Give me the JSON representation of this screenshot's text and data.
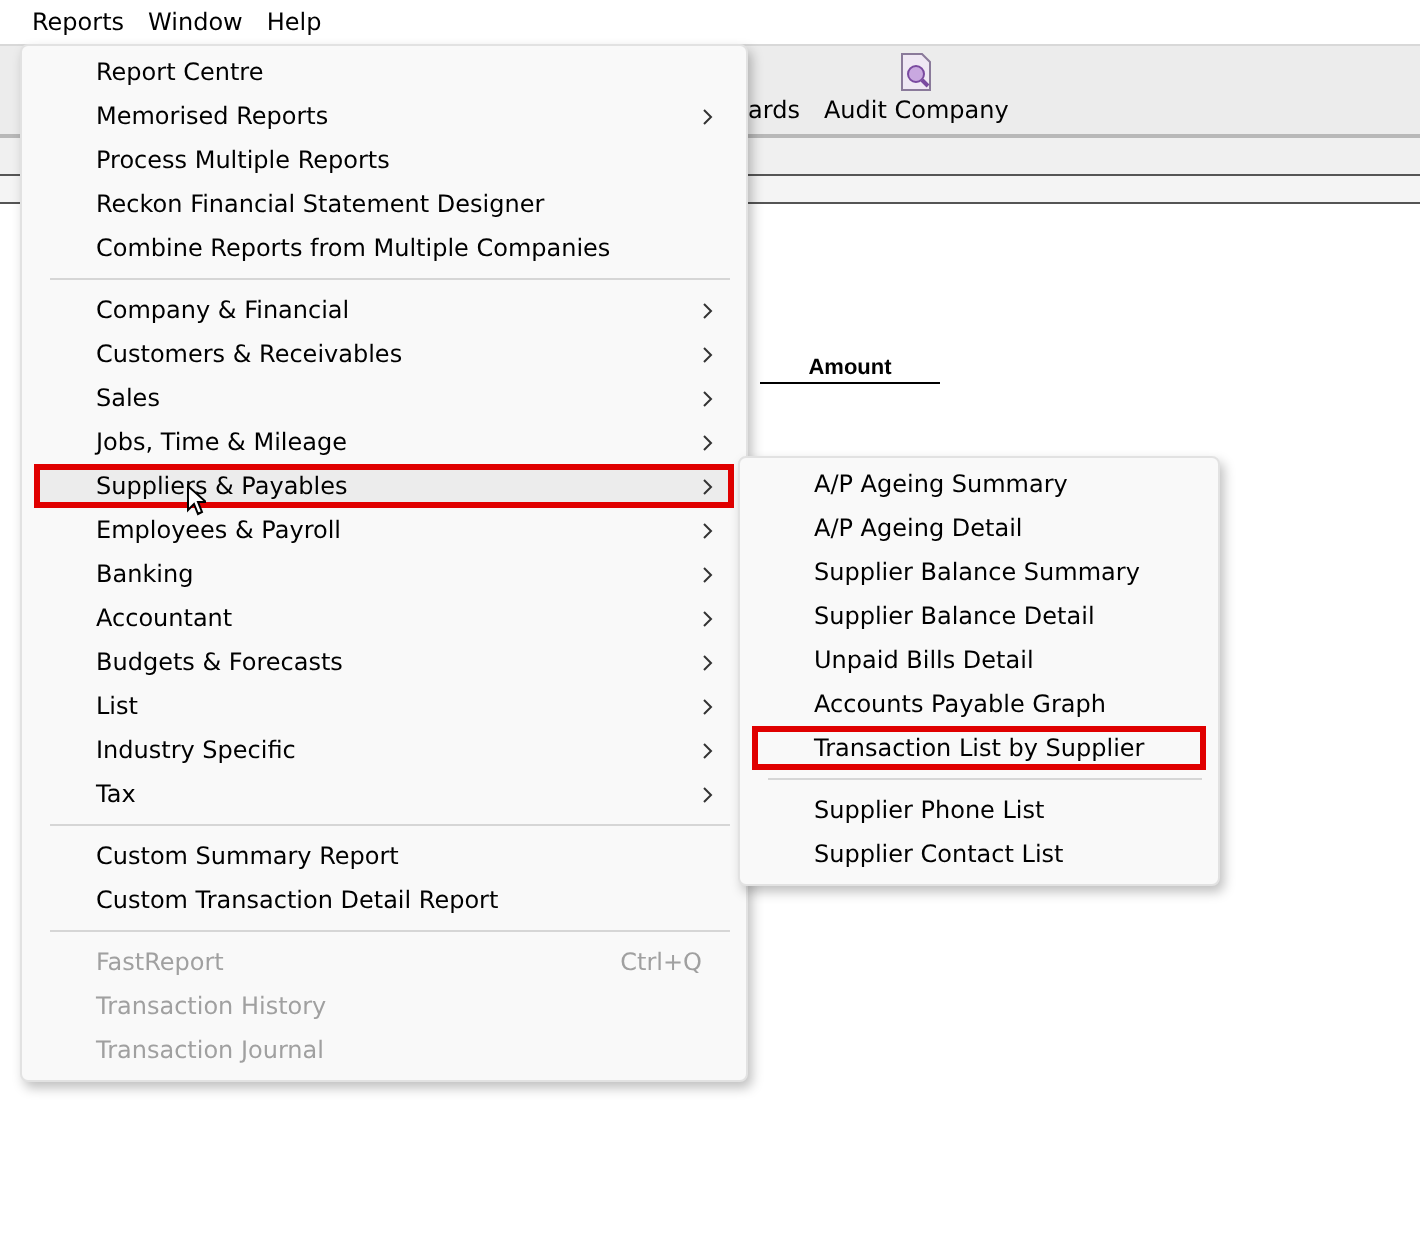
{
  "menubar": [
    {
      "label": "Reports"
    },
    {
      "label": "Window"
    },
    {
      "label": "Help"
    }
  ],
  "toolbar": [
    {
      "label": "ards",
      "icon": false
    },
    {
      "label": "Audit Company",
      "icon": true
    }
  ],
  "report": {
    "column": "Amount"
  },
  "menu": {
    "sections": [
      [
        {
          "label": "Report Centre",
          "submenu": false,
          "disabled": false,
          "selected": false,
          "highlighted": false
        },
        {
          "label": "Memorised Reports",
          "submenu": true,
          "disabled": false,
          "selected": false,
          "highlighted": false
        },
        {
          "label": "Process Multiple Reports",
          "submenu": false,
          "disabled": false,
          "selected": false,
          "highlighted": false
        },
        {
          "label": "Reckon Financial Statement Designer",
          "submenu": false,
          "disabled": false,
          "selected": false,
          "highlighted": false
        },
        {
          "label": "Combine Reports from Multiple Companies",
          "submenu": false,
          "disabled": false,
          "selected": false,
          "highlighted": false
        }
      ],
      [
        {
          "label": "Company & Financial",
          "submenu": true,
          "disabled": false,
          "selected": false,
          "highlighted": false
        },
        {
          "label": "Customers & Receivables",
          "submenu": true,
          "disabled": false,
          "selected": false,
          "highlighted": false
        },
        {
          "label": "Sales",
          "submenu": true,
          "disabled": false,
          "selected": false,
          "highlighted": false
        },
        {
          "label": "Jobs, Time & Mileage",
          "submenu": true,
          "disabled": false,
          "selected": false,
          "highlighted": false
        },
        {
          "label": "Suppliers & Payables",
          "submenu": true,
          "disabled": false,
          "selected": true,
          "highlighted": true
        },
        {
          "label": "Employees & Payroll",
          "submenu": true,
          "disabled": false,
          "selected": false,
          "highlighted": false
        },
        {
          "label": "Banking",
          "submenu": true,
          "disabled": false,
          "selected": false,
          "highlighted": false
        },
        {
          "label": "Accountant",
          "submenu": true,
          "disabled": false,
          "selected": false,
          "highlighted": false
        },
        {
          "label": "Budgets & Forecasts",
          "submenu": true,
          "disabled": false,
          "selected": false,
          "highlighted": false
        },
        {
          "label": "List",
          "submenu": true,
          "disabled": false,
          "selected": false,
          "highlighted": false
        },
        {
          "label": "Industry Specific",
          "submenu": true,
          "disabled": false,
          "selected": false,
          "highlighted": false
        },
        {
          "label": "Tax",
          "submenu": true,
          "disabled": false,
          "selected": false,
          "highlighted": false
        }
      ],
      [
        {
          "label": "Custom Summary Report",
          "submenu": false,
          "disabled": false,
          "selected": false,
          "highlighted": false
        },
        {
          "label": "Custom Transaction Detail Report",
          "submenu": false,
          "disabled": false,
          "selected": false,
          "highlighted": false
        }
      ],
      [
        {
          "label": "FastReport",
          "shortcut": "Ctrl+Q",
          "submenu": false,
          "disabled": true,
          "selected": false,
          "highlighted": false
        },
        {
          "label": "Transaction History",
          "submenu": false,
          "disabled": true,
          "selected": false,
          "highlighted": false
        },
        {
          "label": "Transaction Journal",
          "submenu": false,
          "disabled": true,
          "selected": false,
          "highlighted": false
        }
      ]
    ]
  },
  "submenu": {
    "sections": [
      [
        {
          "label": "A/P Ageing Summary",
          "highlighted": false
        },
        {
          "label": "A/P Ageing Detail",
          "highlighted": false
        },
        {
          "label": "Supplier Balance Summary",
          "highlighted": false
        },
        {
          "label": "Supplier Balance Detail",
          "highlighted": false
        },
        {
          "label": "Unpaid Bills Detail",
          "highlighted": false
        },
        {
          "label": "Accounts Payable Graph",
          "highlighted": false
        },
        {
          "label": "Transaction List by Supplier",
          "highlighted": true
        }
      ],
      [
        {
          "label": "Supplier Phone List",
          "highlighted": false
        },
        {
          "label": "Supplier Contact List",
          "highlighted": false
        }
      ]
    ]
  }
}
